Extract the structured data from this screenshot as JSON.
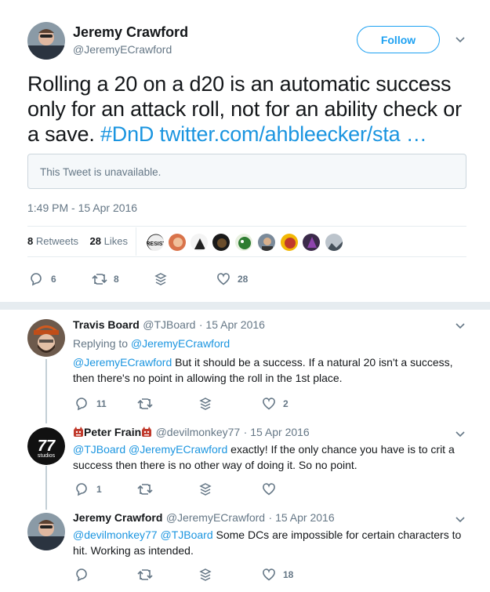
{
  "tweet": {
    "author_name": "Jeremy Crawford",
    "author_handle": "@JeremyECrawford",
    "follow_label": "Follow",
    "text": "Rolling a 20 on a d20 is an automatic success only for an attack roll, not for an ability check or a save.",
    "hashtag": "#DnD",
    "link": "twitter.com/ahbleecker/sta …",
    "quote_unavailable": "This Tweet is unavailable.",
    "timestamp": "1:49 PM - 15 Apr 2016",
    "retweets_count": "8",
    "retweets_label": "Retweets",
    "likes_count": "28",
    "likes_label": "Likes",
    "likers": [
      "RESIST avatar",
      "avatar-2",
      "avatar-3",
      "avatar-4",
      "avatar-5",
      "avatar-6",
      "avatar-7",
      "avatar-8",
      "avatar-9"
    ],
    "actions": {
      "reply_count": "6",
      "retweet_count": "8",
      "like_count": "28"
    }
  },
  "replies": [
    {
      "name": "Travis Board",
      "handle": "@TJBoard",
      "date": "· 15 Apr 2016",
      "replying_prefix": "Replying to",
      "replying_to": "@JeremyECrawford",
      "mention": "@JeremyECrawford",
      "text": " But it should be a success. If a natural 20 isn't a success, then there's no point in allowing the roll in the 1st place.",
      "reply_count": "11",
      "retweet_count": "",
      "like_count": "2"
    },
    {
      "name": "Peter Frain",
      "handle": "@devilmonkey77",
      "date": "· 15 Apr 2016",
      "mention": "@TJBoard @JeremyECrawford",
      "text": " exactly! If the only chance you have is to crit a success then there is no other way of doing it. So no point.",
      "reply_count": "1",
      "retweet_count": "",
      "like_count": ""
    },
    {
      "name": "Jeremy Crawford",
      "handle": "@JeremyECrawford",
      "date": "· 15 Apr 2016",
      "mention": "@devilmonkey77 @TJBoard",
      "text": " Some DCs are impossible for certain characters to hit. Working as intended.",
      "reply_count": "",
      "retweet_count": "",
      "like_count": "18"
    }
  ],
  "colors": {
    "link": "#1b95e0",
    "follow": "#1da1f2",
    "meta": "#657786"
  }
}
